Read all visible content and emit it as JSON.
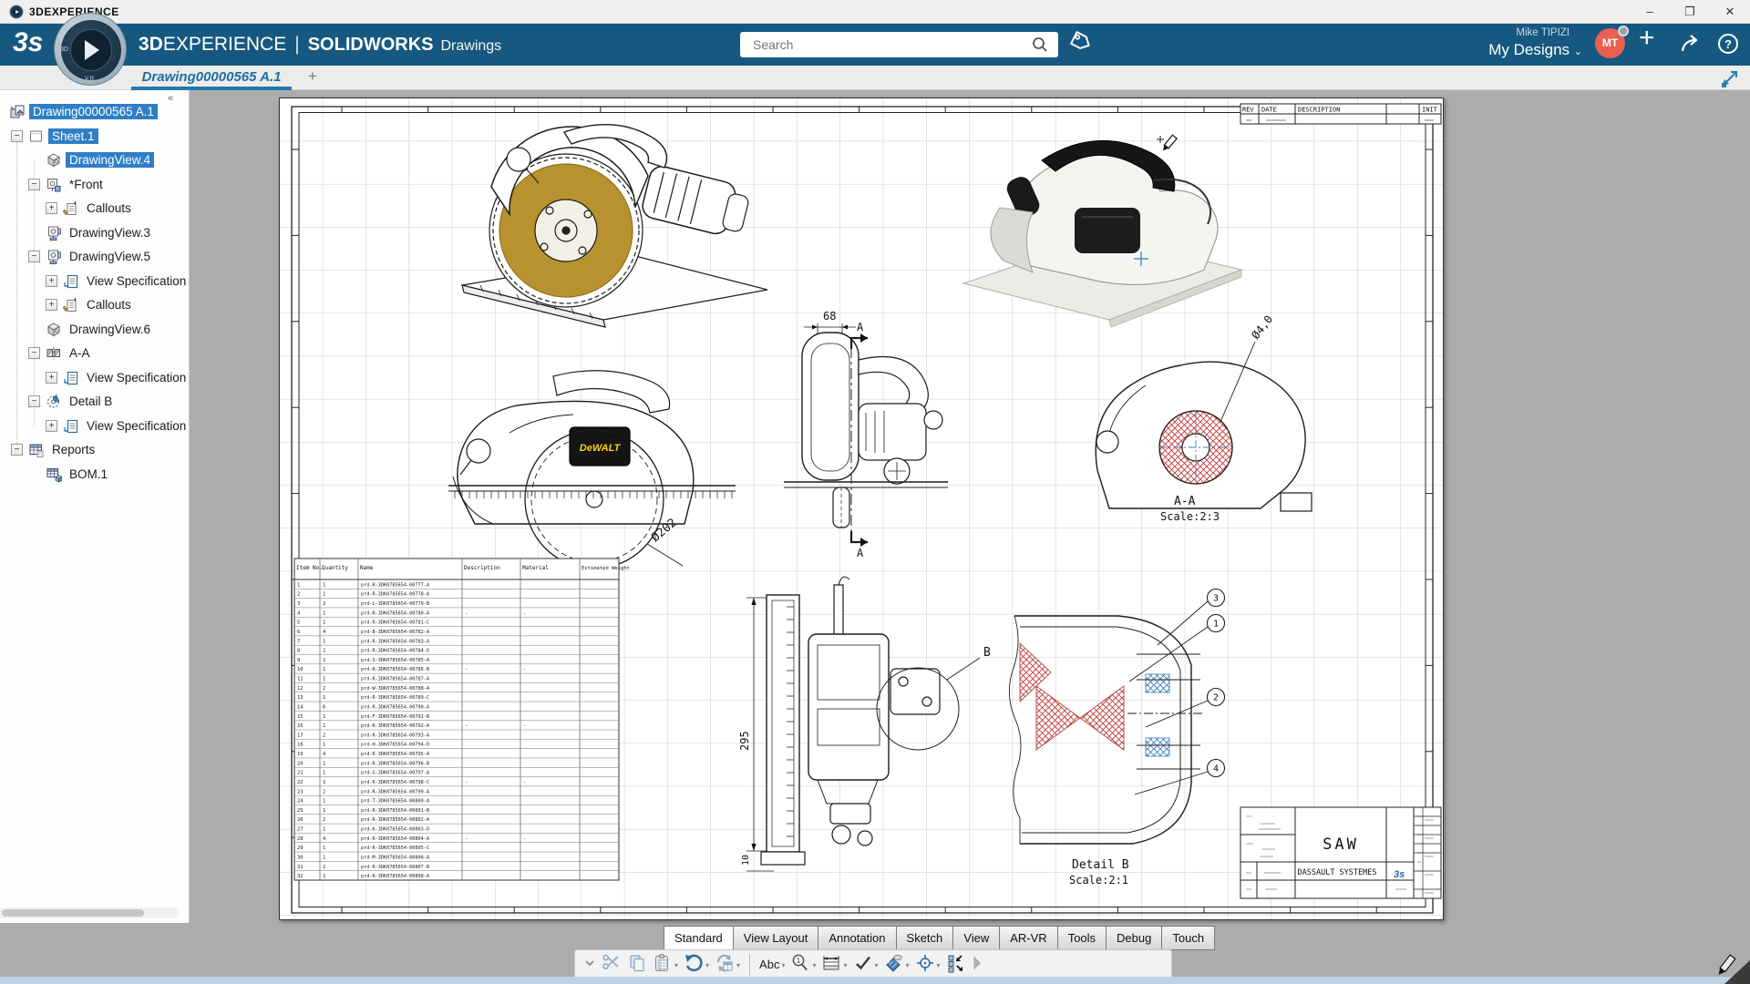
{
  "window": {
    "title": "3DEXPERIENCE"
  },
  "header": {
    "brand_bold": "3D",
    "brand_light": "EXPERIENCE",
    "brand_divider": "|",
    "brand_product": "SOLIDWORKS",
    "brand_app": "Drawings",
    "compass_left": "3D",
    "compass_bottom": "V.R",
    "search_placeholder": "Search",
    "user_name": "Mike TIPIZI",
    "workspace": "My Designs",
    "avatar_initials": "MT"
  },
  "tabbar": {
    "document_tab": "Drawing00000565 A.1",
    "new_tab": "+",
    "collapse_chevrons": "«"
  },
  "tree": {
    "items": [
      {
        "label": "Drawing00000565 A.1",
        "level": 0,
        "icon": "drawing-root",
        "expand": "",
        "selected": true
      },
      {
        "label": "Sheet.1",
        "level": 1,
        "icon": "sheet",
        "expand": "minus",
        "selected": true
      },
      {
        "label": "DrawingView.4",
        "level": 2,
        "icon": "iso-view",
        "expand": "",
        "selected": true
      },
      {
        "label": "*Front",
        "level": 2,
        "icon": "front-view",
        "expand": "minus",
        "selected": false
      },
      {
        "label": "Callouts",
        "level": 3,
        "icon": "callouts",
        "expand": "plus",
        "selected": false
      },
      {
        "label": "DrawingView.3",
        "level": 2,
        "icon": "proj-view",
        "expand": "",
        "selected": false
      },
      {
        "label": "DrawingView.5",
        "level": 2,
        "icon": "proj-view",
        "expand": "minus",
        "selected": false
      },
      {
        "label": "View Specification",
        "level": 3,
        "icon": "view-spec",
        "expand": "plus",
        "selected": false
      },
      {
        "label": "Callouts",
        "level": 3,
        "icon": "callouts",
        "expand": "plus",
        "selected": false
      },
      {
        "label": "DrawingView.6",
        "level": 2,
        "icon": "iso-view",
        "expand": "",
        "selected": false
      },
      {
        "label": "A-A",
        "level": 2,
        "icon": "section",
        "expand": "minus",
        "selected": false
      },
      {
        "label": "View Specification",
        "level": 3,
        "icon": "view-spec",
        "expand": "plus",
        "selected": false
      },
      {
        "label": "Detail B",
        "level": 2,
        "icon": "detail",
        "expand": "minus",
        "selected": false
      },
      {
        "label": "View Specification",
        "level": 3,
        "icon": "view-spec",
        "expand": "plus",
        "selected": false
      },
      {
        "label": "Reports",
        "level": 1,
        "icon": "reports",
        "expand": "minus",
        "selected": false
      },
      {
        "label": "BOM.1",
        "level": 2,
        "icon": "bom",
        "expand": "",
        "selected": false
      }
    ]
  },
  "drawing": {
    "labels": {
      "dim_width": "68",
      "dim_blade": "Ø202",
      "dim_bore": "Ø4,0",
      "dim_height": "295",
      "dim_base": "10",
      "section_marker": "A",
      "section_title": "A-A",
      "section_scale": "Scale:2:3",
      "detail_marker": "B",
      "detail_title": "Detail B",
      "detail_scale": "Scale:2:1",
      "badge": "DeWALT"
    },
    "balloons": [
      "3",
      "1",
      "2",
      "4"
    ],
    "rev_table": {
      "headers": [
        "REV",
        "DATE",
        "DESCRIPTION",
        "INIT"
      ]
    },
    "title_block": {
      "title": "SAW",
      "company": "DASSAULT SYSTEMES"
    },
    "bom": {
      "headers": [
        "Item No.",
        "Quantity",
        "Name",
        "Description",
        "Material",
        "Estimated Weight"
      ],
      "rows": [
        [
          "1",
          "prd-R-3DK0785654-00777-A"
        ],
        [
          "1",
          "prd-R-3DK0785654-00778-A"
        ],
        [
          "2",
          "prd-L-3DK0785654-00779-B"
        ],
        [
          "1",
          "prd-R-3DK0785654-00780-A"
        ],
        [
          "1",
          "prd-R-3DK0785654-00781-C"
        ],
        [
          "4",
          "prd-B-3DK0785654-00782-A"
        ],
        [
          "1",
          "prd-R-3DK0785654-00783-A"
        ],
        [
          "2",
          "prd-R-3DK0785654-00784-D"
        ],
        [
          "1",
          "prd-S-3DK0785654-00785-A"
        ],
        [
          "1",
          "prd-R-3DK0785654-00786-B"
        ],
        [
          "1",
          "prd-R-3DK0785654-00787-A"
        ],
        [
          "2",
          "prd-W-3DK0785654-00788-A"
        ],
        [
          "1",
          "prd-R-3DK0785654-00789-C"
        ],
        [
          "6",
          "prd-R-3DK0785654-00790-A"
        ],
        [
          "1",
          "prd-F-3DK0785654-00791-B"
        ],
        [
          "1",
          "prd-R-3DK0785654-00792-A"
        ],
        [
          "2",
          "prd-R-3DK0785654-00793-A"
        ],
        [
          "1",
          "prd-H-3DK0785654-00794-D"
        ],
        [
          "4",
          "prd-R-3DK0785654-00795-A"
        ],
        [
          "1",
          "prd-R-3DK0785654-00796-B"
        ],
        [
          "1",
          "prd-G-3DK0785654-00797-A"
        ],
        [
          "1",
          "prd-R-3DK0785654-00798-C"
        ],
        [
          "2",
          "prd-R-3DK0785654-00799-A"
        ],
        [
          "1",
          "prd-T-3DK0785654-00800-A"
        ],
        [
          "1",
          "prd-R-3DK0785654-00801-B"
        ],
        [
          "2",
          "prd-R-3DK0785654-00802-A"
        ],
        [
          "1",
          "prd-K-3DK0785654-00803-D"
        ],
        [
          "4",
          "prd-R-3DK0785654-00804-A"
        ],
        [
          "1",
          "prd-R-3DK0785654-00805-C"
        ],
        [
          "1",
          "prd-M-3DK0785654-00806-A"
        ],
        [
          "2",
          "prd-R-3DK0785654-00807-B"
        ],
        [
          "1",
          "prd-R-3DK0785654-00808-A"
        ]
      ]
    }
  },
  "ribbon": {
    "tabs": [
      {
        "label": "Standard",
        "active": true
      },
      {
        "label": "View Layout",
        "active": false
      },
      {
        "label": "Annotation",
        "active": false
      },
      {
        "label": "Sketch",
        "active": false
      },
      {
        "label": "View",
        "active": false
      },
      {
        "label": "AR-VR",
        "active": false
      },
      {
        "label": "Tools",
        "active": false
      },
      {
        "label": "Debug",
        "active": false
      },
      {
        "label": "Touch",
        "active": false
      }
    ]
  },
  "toolbar": {
    "abc_label": "Abc",
    "items": [
      {
        "name": "menu-chevron",
        "dropdown": false
      },
      {
        "name": "cut",
        "dropdown": false
      },
      {
        "name": "copy",
        "dropdown": false
      },
      {
        "name": "paste",
        "dropdown": true
      },
      {
        "name": "undo",
        "dropdown": true
      },
      {
        "name": "update",
        "dropdown": true
      },
      {
        "name": "separator",
        "dropdown": false
      },
      {
        "name": "spellcheck",
        "dropdown": true
      },
      {
        "name": "auto-balloon",
        "dropdown": true
      },
      {
        "name": "smart-dimension",
        "dropdown": true
      },
      {
        "name": "validate",
        "dropdown": true
      },
      {
        "name": "area-hatch",
        "dropdown": true
      },
      {
        "name": "origin-target",
        "dropdown": true
      },
      {
        "name": "bom-insert",
        "dropdown": false
      },
      {
        "name": "more",
        "dropdown": false
      }
    ]
  }
}
